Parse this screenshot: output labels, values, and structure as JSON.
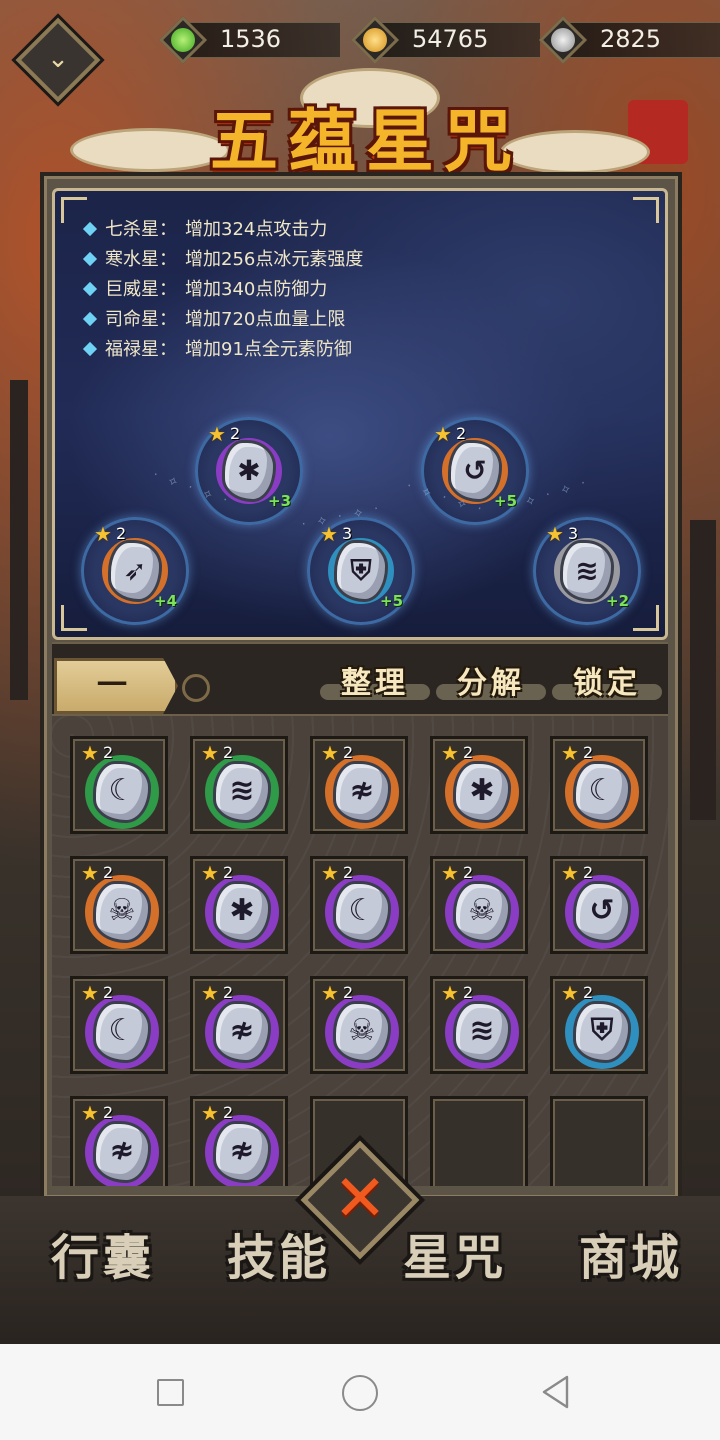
{
  "resources": [
    {
      "name": "energy",
      "value": "1536",
      "icon": "green-flame-icon",
      "color": "#6fd43a"
    },
    {
      "name": "gold",
      "value": "54765",
      "icon": "gold-coin-icon",
      "color": "#f2b233"
    },
    {
      "name": "silver",
      "value": "2825",
      "icon": "silver-coin-icon",
      "color": "#c9c9c9"
    }
  ],
  "title": "五蕴星咒",
  "stats": [
    {
      "star": "七杀星：",
      "effect": "增加324点攻击力"
    },
    {
      "star": "寒水星：",
      "effect": "增加256点冰元素强度"
    },
    {
      "star": "巨威星：",
      "effect": "增加340点防御力"
    },
    {
      "star": "司命星：",
      "effect": "增加720点血量上限"
    },
    {
      "star": "福禄星：",
      "effect": "增加91点全元素防御"
    }
  ],
  "equipped": [
    {
      "level": "2",
      "bonus": "+4",
      "icon": "arrow-rune-icon",
      "ring": "#d4702a"
    },
    {
      "level": "2",
      "bonus": "+3",
      "icon": "snowflake-rune-icon",
      "ring": "#8b3cc4"
    },
    {
      "level": "3",
      "bonus": "+5",
      "icon": "shield-rune-icon",
      "ring": "#2f8fbf"
    },
    {
      "level": "2",
      "bonus": "+5",
      "icon": "muscle-rune-icon",
      "ring": "#d4702a"
    },
    {
      "level": "3",
      "bonus": "+2",
      "icon": "wing-rune-icon",
      "ring": "#9a9aa0"
    }
  ],
  "tabs": {
    "active": "一",
    "sort": "整理",
    "decompose": "分解",
    "lock": "锁定"
  },
  "inventory": [
    {
      "level": "2",
      "icon": "flame-rune-icon",
      "ring": "#2f9a48"
    },
    {
      "level": "2",
      "icon": "wing-rune-icon",
      "ring": "#2f9a48"
    },
    {
      "level": "2",
      "icon": "claw-rune-icon",
      "ring": "#d4702a"
    },
    {
      "level": "2",
      "icon": "snowflake-rune-icon",
      "ring": "#d4702a"
    },
    {
      "level": "2",
      "icon": "flame-rune-icon",
      "ring": "#d4702a"
    },
    {
      "level": "2",
      "icon": "skull-rune-icon",
      "ring": "#d4702a"
    },
    {
      "level": "2",
      "icon": "snowflake-rune-icon",
      "ring": "#8b3cc4"
    },
    {
      "level": "2",
      "icon": "flame-rune-icon",
      "ring": "#8b3cc4"
    },
    {
      "level": "2",
      "icon": "skull-rune-icon",
      "ring": "#8b3cc4"
    },
    {
      "level": "2",
      "icon": "muscle-rune-icon",
      "ring": "#8b3cc4"
    },
    {
      "level": "2",
      "icon": "flame-rune-icon",
      "ring": "#8b3cc4"
    },
    {
      "level": "2",
      "icon": "claw-rune-icon",
      "ring": "#8b3cc4"
    },
    {
      "level": "2",
      "icon": "skull-rune-icon",
      "ring": "#8b3cc4"
    },
    {
      "level": "2",
      "icon": "wing-rune-icon",
      "ring": "#8b3cc4"
    },
    {
      "level": "2",
      "icon": "shield-rune-icon",
      "ring": "#2f8fbf"
    },
    {
      "level": "2",
      "icon": "claw-rune-icon",
      "ring": "#8b3cc4"
    },
    {
      "level": "2",
      "icon": "claw-rune-icon",
      "ring": "#8b3cc4"
    },
    {
      "empty": true
    },
    {
      "empty": true
    },
    {
      "empty": true
    }
  ],
  "bottom_nav": [
    "行囊",
    "技能",
    "星咒",
    "商城"
  ]
}
